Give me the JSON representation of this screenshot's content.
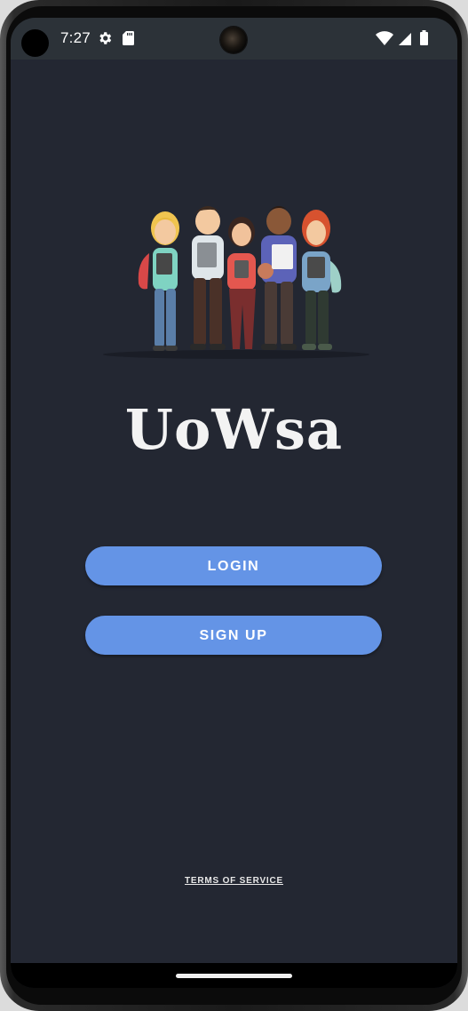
{
  "status_bar": {
    "time": "7:27",
    "left_icons": [
      "gear-icon",
      "sd-card-icon"
    ],
    "right_icons": [
      "wifi-icon",
      "cell-signal-icon",
      "battery-icon"
    ]
  },
  "app": {
    "title": "UoWsa",
    "hero_image": "students-group-illustration"
  },
  "buttons": {
    "login_label": "LOGIN",
    "signup_label": "SIGN UP"
  },
  "footer": {
    "terms_label": "TERMS OF SERVICE"
  },
  "colors": {
    "background": "#232732",
    "status_bar": "#2c3238",
    "button": "#6494e6",
    "title": "#f3f3f3"
  }
}
